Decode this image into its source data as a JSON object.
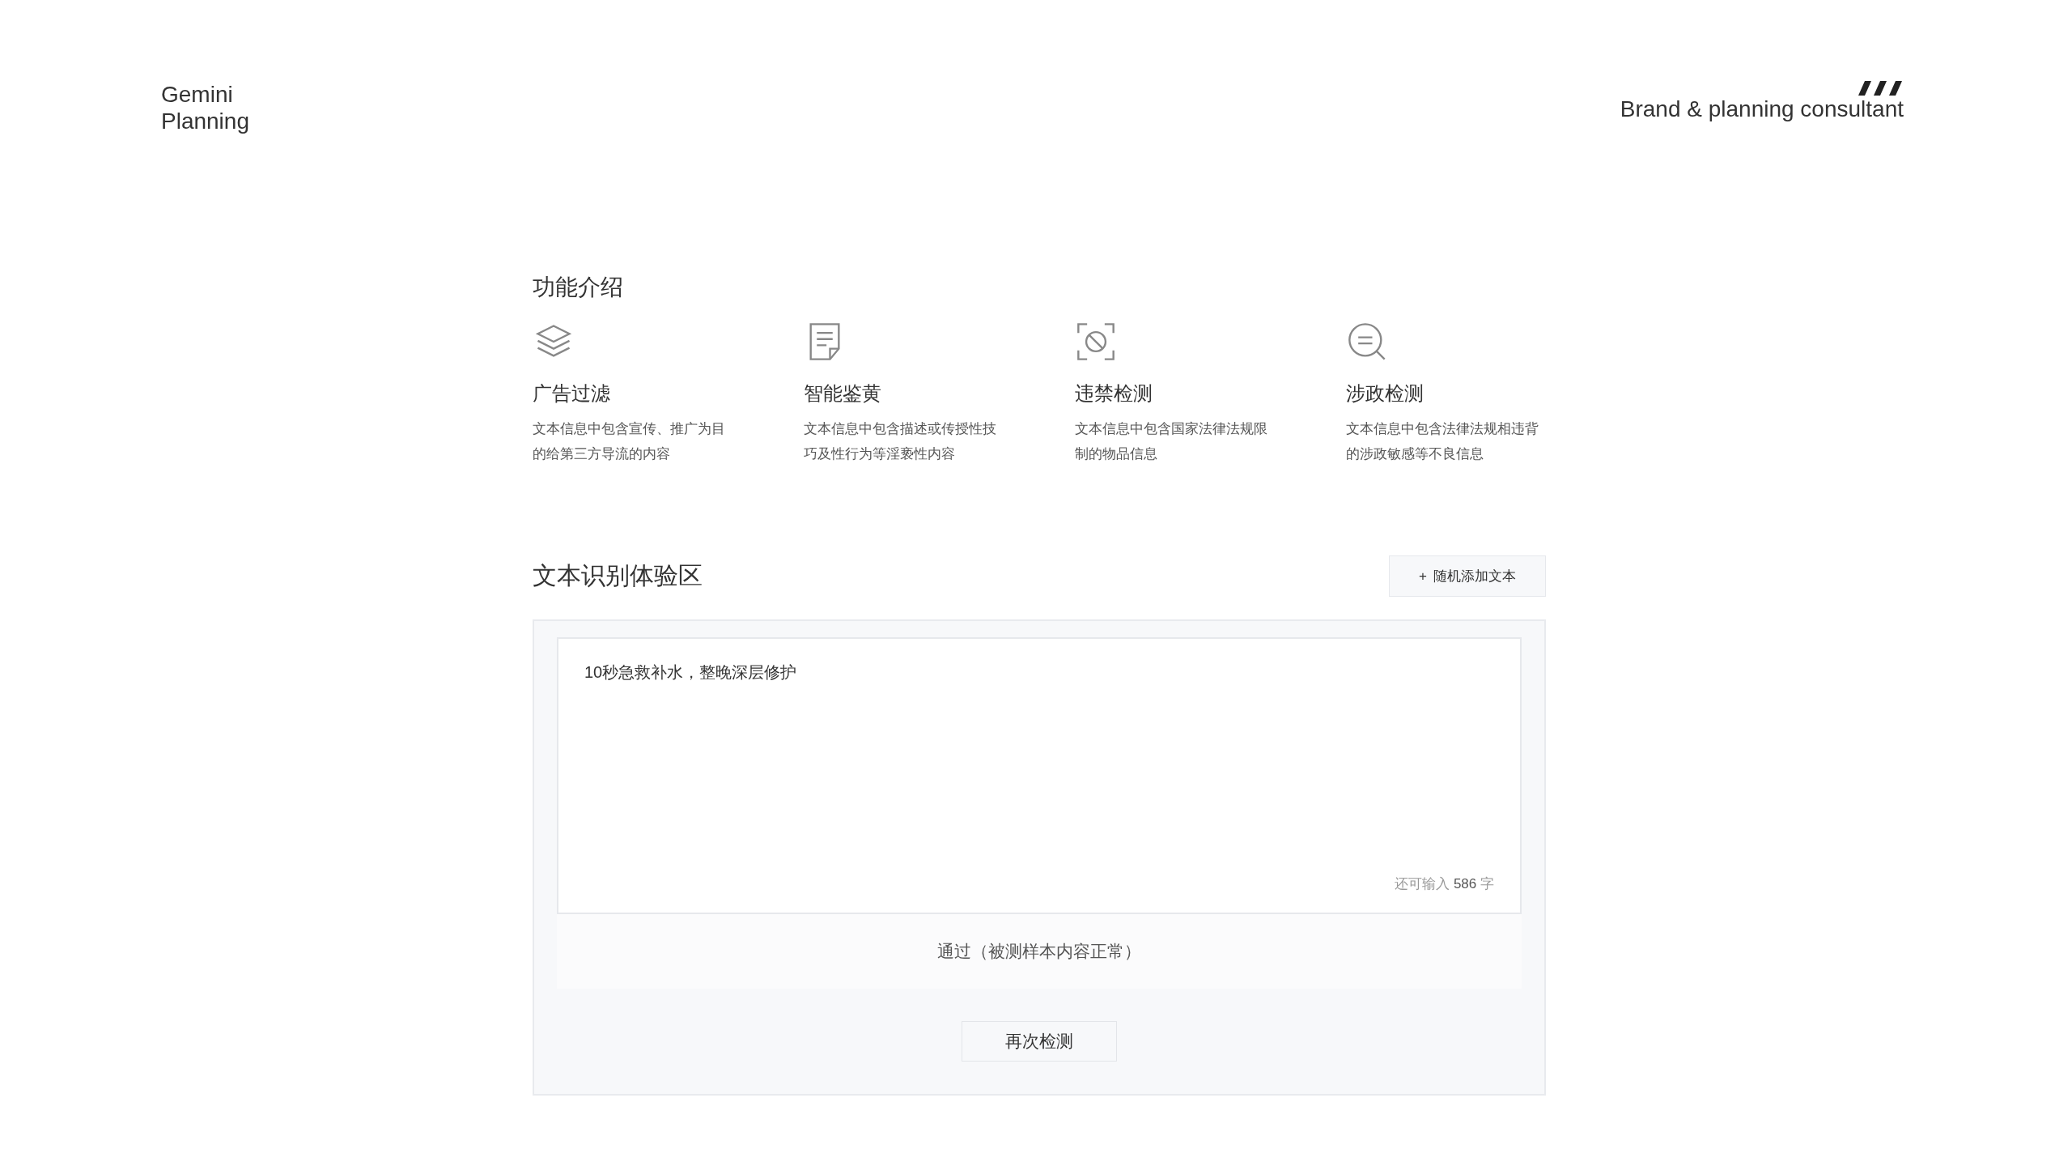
{
  "brand": {
    "line_1": "Gemini",
    "line_2": "Planning"
  },
  "tagline": "Brand & planning consultant",
  "features": {
    "title": "功能介绍",
    "items": [
      {
        "kind": "layers",
        "title": "广告过滤",
        "description": "文本信息中包含宣传、推广为目的给第三方导流的内容"
      },
      {
        "kind": "document",
        "title": "智能鉴黄",
        "description": "文本信息中包含描述或传授性技巧及性行为等淫亵性内容"
      },
      {
        "kind": "prohibited",
        "title": "违禁检测",
        "description": "文本信息中包含国家法律法规限制的物品信息"
      },
      {
        "kind": "search",
        "title": "涉政检测",
        "description": "文本信息中包含法律法规相违背的涉政敏感等不良信息"
      }
    ]
  },
  "demo": {
    "title": "文本识别体验区",
    "add_button": {
      "icon": "+",
      "label": "随机添加文本"
    },
    "input": {
      "value": "10秒急救补水，整晚深层修护",
      "counter_prefix": "还可输入",
      "counter_value": "586",
      "counter_suffix": "字"
    },
    "result": "通过（被测样本内容正常）",
    "retry_button": "再次检测"
  }
}
